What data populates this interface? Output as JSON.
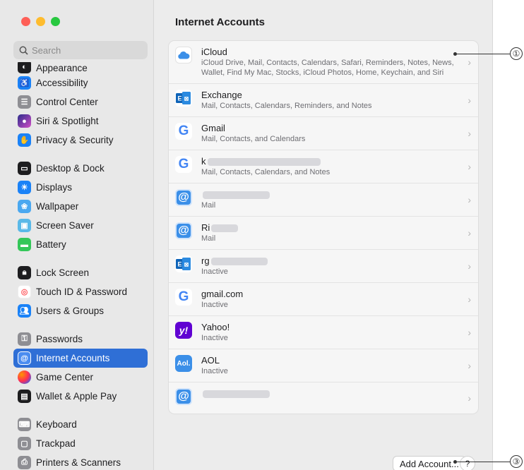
{
  "search": {
    "placeholder": "Search"
  },
  "sidebar": {
    "items": [
      {
        "label": "Appearance",
        "icon": "appearance-icon",
        "color": "#1d1d1f"
      },
      {
        "label": "Accessibility",
        "icon": "accessibility-icon",
        "color": "#1a82f7"
      },
      {
        "label": "Control Center",
        "icon": "control-center-icon",
        "color": "#8e8e93"
      },
      {
        "label": "Siri & Spotlight",
        "icon": "siri-icon",
        "color": "#6b3fd6"
      },
      {
        "label": "Privacy & Security",
        "icon": "hand-icon",
        "color": "#1a82f7"
      },
      {
        "label": "Desktop & Dock",
        "icon": "desktop-dock-icon",
        "color": "#1d1d1f"
      },
      {
        "label": "Displays",
        "icon": "sun-icon",
        "color": "#1a82f7"
      },
      {
        "label": "Wallpaper",
        "icon": "wallpaper-icon",
        "color": "#4aa8f0"
      },
      {
        "label": "Screen Saver",
        "icon": "screen-saver-icon",
        "color": "#5ab9e8"
      },
      {
        "label": "Battery",
        "icon": "battery-icon",
        "color": "#34c759"
      },
      {
        "label": "Lock Screen",
        "icon": "lock-icon",
        "color": "#1d1d1f"
      },
      {
        "label": "Touch ID & Password",
        "icon": "fingerprint-icon",
        "color": "#ff6b6b"
      },
      {
        "label": "Users & Groups",
        "icon": "users-icon",
        "color": "#1a82f7"
      },
      {
        "label": "Passwords",
        "icon": "key-icon",
        "color": "#8e8e93"
      },
      {
        "label": "Internet Accounts",
        "icon": "at-icon",
        "color": "#1a82f7"
      },
      {
        "label": "Game Center",
        "icon": "game-center-icon",
        "color": "#ff9500"
      },
      {
        "label": "Wallet & Apple Pay",
        "icon": "wallet-icon",
        "color": "#1d1d1f"
      },
      {
        "label": "Keyboard",
        "icon": "keyboard-icon",
        "color": "#8e8e93"
      },
      {
        "label": "Trackpad",
        "icon": "trackpad-icon",
        "color": "#8e8e93"
      },
      {
        "label": "Printers & Scanners",
        "icon": "printer-icon",
        "color": "#8e8e93"
      }
    ]
  },
  "main": {
    "title": "Internet Accounts",
    "accounts": [
      {
        "name": "iCloud",
        "detail": "iCloud Drive, Mail, Contacts, Calendars, Safari, Reminders, Notes, News, Wallet, Find My Mac, Stocks, iCloud Photos, Home, Keychain, and Siri",
        "icon": "icloud-icon"
      },
      {
        "name": "Exchange",
        "detail": "Mail, Contacts, Calendars, Reminders, and Notes",
        "icon": "exchange-icon"
      },
      {
        "name": "Gmail",
        "detail": "Mail, Contacts, and Calendars",
        "icon": "google-icon"
      },
      {
        "name": "k",
        "detail": "Mail, Contacts, Calendars, and Notes",
        "icon": "google-icon"
      },
      {
        "name": "",
        "detail": "Mail",
        "icon": "at-icon"
      },
      {
        "name": "Ri",
        "detail": "Mail",
        "icon": "at-icon"
      },
      {
        "name": "rg",
        "detail": "Inactive",
        "icon": "exchange-icon"
      },
      {
        "name": "gmail.com",
        "detail": "Inactive",
        "icon": "google-icon"
      },
      {
        "name": "Yahoo!",
        "detail": "Inactive",
        "icon": "yahoo-icon"
      },
      {
        "name": "AOL",
        "detail": "Inactive",
        "icon": "aol-icon"
      },
      {
        "name": "",
        "detail": "",
        "icon": "at-icon"
      }
    ],
    "add_account_label": "Add Account...",
    "help_label": "?"
  },
  "callouts": {
    "first": "①",
    "third": "③"
  }
}
